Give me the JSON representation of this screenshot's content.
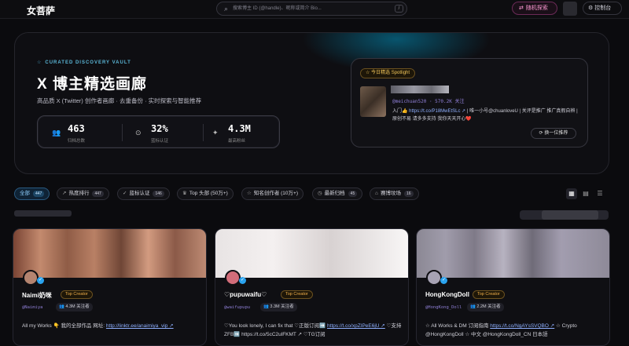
{
  "topbar": {
    "logo": "女菩萨",
    "search_placeholder": "搜索博主 ID (@handle)、昵称或简介 Bio...",
    "search_shortcut": "/",
    "random_label": "随机探索",
    "console_label": "控制台"
  },
  "hero": {
    "eyebrow": "CURATED DISCOVERY VAULT",
    "title": "X 博主精选画廊",
    "subtitle": "高品质 X (Twitter) 创作者画廊 · 去重备份 · 实时探索与智能推荐",
    "stats": [
      {
        "icon": "users-icon",
        "value": "463",
        "label": "归档总数"
      },
      {
        "icon": "check-circle-icon",
        "value": "32%",
        "label": "蓝标认证"
      },
      {
        "icon": "sparkle-icon",
        "value": "4.3M",
        "label": "最高粉丝"
      }
    ]
  },
  "spotlight": {
    "badge": "今日精选 Spotlight",
    "handle": "@meichuan520 · 570.2K 关注",
    "bio_part1": "入门👍 ",
    "bio_link": "https://t.co/P18MwEtSLc ↗",
    "bio_part2": " | 唯一小号@chuanloveU | 关评是推广 推广真假自辨 | 原创不易 请多多支持 我你天天开心❤️",
    "refresh_label": "换一位推荐"
  },
  "tabs": [
    {
      "label": "全部",
      "count": "447",
      "icon": "",
      "active": true
    },
    {
      "label": "热度排行",
      "count": "447",
      "icon": "↗",
      "active": false
    },
    {
      "label": "蓝标认证",
      "count": "146",
      "icon": "✓",
      "active": false
    },
    {
      "label": "Top 头部 (50万+)",
      "count": "",
      "icon": "♛",
      "active": false
    },
    {
      "label": "知名创作者 (10万+)",
      "count": "",
      "icon": "☆",
      "active": false
    },
    {
      "label": "最新归档",
      "count": "45",
      "icon": "◷",
      "active": false
    },
    {
      "label": "赛博坟场",
      "count": "16",
      "icon": "⌂",
      "active": false
    }
  ],
  "cards": [
    {
      "name": "Naimi奶咪",
      "tag": "Top Creator",
      "handle": "@Naimiya",
      "followers": "4.3M 关注者",
      "bio_text": "All my Works 👇 我的全部作品 网址: ",
      "bio_link": "http://linktr.ee/anaimiya_vip ↗",
      "bio_text2": ""
    },
    {
      "name": "♡pupuwaifu♡",
      "tag": "Top Creator",
      "handle": "@waifupupu",
      "followers": "3.3M 关注者",
      "bio_text": "♡You look lonely, I can fix that ♡正版订阅➡️ ",
      "bio_link": "https://t.co/xpZIPeE6jU ↗",
      "bio_text2": " ♡支持ZFB➡️ https://t.co/5cC2ulFKMT ↗ ♡TG订阅"
    },
    {
      "name": "HongKongDoll",
      "tag": "Top Creator",
      "handle": "@HongKong_Doll",
      "followers": "2.2M 关注者",
      "bio_text": "☆ All Works & DM 订阅指南 ",
      "bio_link": "https://t.co/NgAYsSVQBO ↗",
      "bio_text2": " ☆ Crypto @HongKongDoll ☆ 中文 @HongKongDoll_CN 日本語"
    }
  ],
  "colors": {
    "accent": "#2aa3ef",
    "gold": "#f2c65a",
    "pink": "#ff9ad5",
    "handle": "#8f7fd6"
  }
}
